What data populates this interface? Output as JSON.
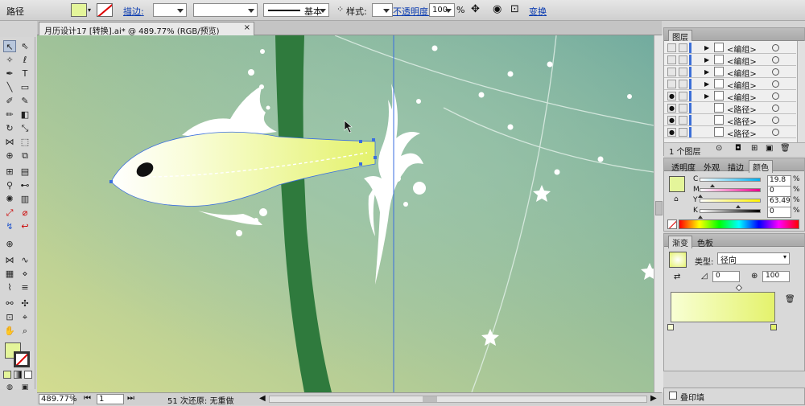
{
  "control_bar": {
    "label": "路径",
    "stroke_link": "描边:",
    "stroke_style": "基本",
    "style_label": "样式:",
    "opacity_link": "不透明度:",
    "opacity_value": "100",
    "percent": "%",
    "transform_link": "变换",
    "fill_color": "#e4f59a"
  },
  "document_tab": {
    "title": "月历设计17 [转换].ai* @ 489.77% (RGB/预览)",
    "close": "×"
  },
  "status_bar": {
    "zoom": "489.77%",
    "page": "1",
    "undo_text": "51 次还原: 无重做"
  },
  "layers_panel": {
    "title": "图层",
    "footer": "1 个图层",
    "rows": [
      {
        "name": "<编组>",
        "eye": false,
        "expand": true
      },
      {
        "name": "<编组>",
        "eye": false,
        "expand": true
      },
      {
        "name": "<编组>",
        "eye": false,
        "expand": true
      },
      {
        "name": "<编组>",
        "eye": false,
        "expand": true
      },
      {
        "name": "<编组>",
        "eye": true,
        "expand": true
      },
      {
        "name": "<路径>",
        "eye": true,
        "expand": false
      },
      {
        "name": "<路径>",
        "eye": true,
        "expand": false
      },
      {
        "name": "<路径>",
        "eye": true,
        "expand": false
      }
    ]
  },
  "color_panel": {
    "tabs": [
      "透明度",
      "外观",
      "描边",
      "颜色"
    ],
    "channels": [
      {
        "label": "C",
        "value": "19.8",
        "fraction": 0.198,
        "grad": "linear-gradient(90deg,#fff,#00aeef)"
      },
      {
        "label": "M",
        "value": "0",
        "fraction": 0,
        "grad": "linear-gradient(90deg,#fff,#ec008c)"
      },
      {
        "label": "Y",
        "value": "63.49",
        "fraction": 0.6349,
        "grad": "linear-gradient(90deg,#fff,#fff200)"
      },
      {
        "label": "K",
        "value": "0",
        "fraction": 0,
        "grad": "linear-gradient(90deg,#fff,#000)"
      }
    ],
    "percent": "%"
  },
  "gradient_panel": {
    "tabs": [
      "渐变",
      "色板"
    ],
    "type_label": "类型:",
    "type_value": "径向",
    "angle": "0",
    "aspect": "100"
  },
  "footer_panel": {
    "overprint": "叠印填"
  },
  "colors": {
    "canvas_left": "#c8d68c",
    "canvas_right": "#74ac9e",
    "stem": "#2f7a3d",
    "guide": "#3a6ee0"
  }
}
